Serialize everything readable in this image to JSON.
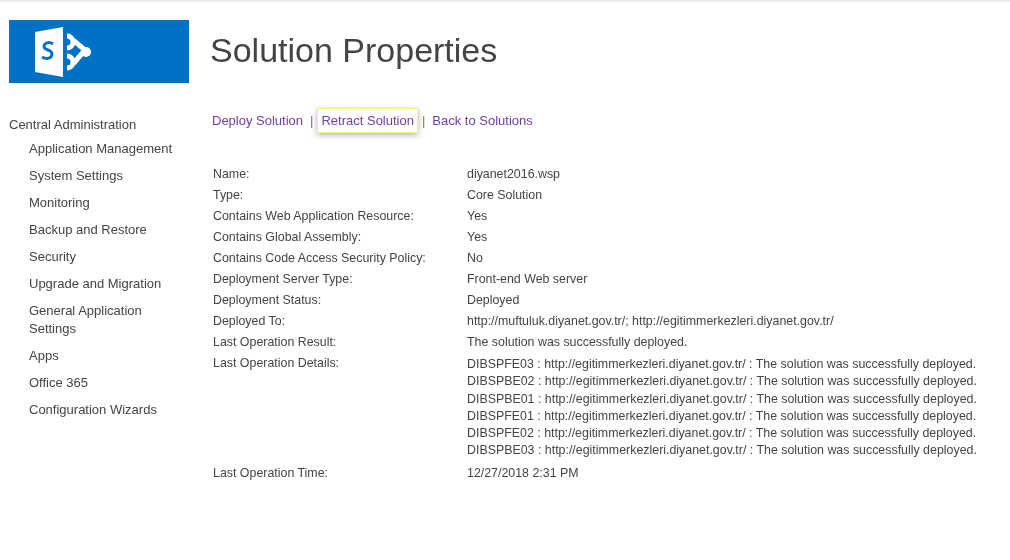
{
  "page_title": "Solution Properties",
  "sidebar": {
    "items": [
      {
        "label": "Central Administration",
        "children": [
          {
            "label": "Application Management"
          },
          {
            "label": "System Settings"
          },
          {
            "label": "Monitoring"
          },
          {
            "label": "Backup and Restore"
          },
          {
            "label": "Security"
          },
          {
            "label": "Upgrade and Migration"
          },
          {
            "label": "General Application Settings"
          },
          {
            "label": "Apps"
          },
          {
            "label": "Office 365"
          },
          {
            "label": "Configuration Wizards"
          }
        ]
      }
    ]
  },
  "action_links": [
    {
      "label": "Deploy Solution",
      "focused": false
    },
    {
      "label": "Retract Solution",
      "focused": true
    },
    {
      "label": "Back to Solutions",
      "focused": false
    }
  ],
  "link_separator": "|",
  "properties": [
    {
      "label": "Name:",
      "values": [
        "diyanet2016.wsp"
      ]
    },
    {
      "label": "Type:",
      "values": [
        "Core Solution"
      ]
    },
    {
      "label": "Contains Web Application Resource:",
      "values": [
        "Yes"
      ]
    },
    {
      "label": "Contains Global Assembly:",
      "values": [
        "Yes"
      ]
    },
    {
      "label": "Contains Code Access Security Policy:",
      "values": [
        "No"
      ]
    },
    {
      "label": "Deployment Server Type:",
      "values": [
        "Front-end Web server"
      ]
    },
    {
      "label": "Deployment Status:",
      "values": [
        "Deployed"
      ]
    },
    {
      "label": "Deployed To:",
      "values": [
        "http://muftuluk.diyanet.gov.tr/; http://egitimmerkezleri.diyanet.gov.tr/"
      ]
    },
    {
      "label": "Last Operation Result:",
      "values": [
        "The solution was successfully deployed."
      ]
    },
    {
      "label": "Last Operation Details:",
      "values": [
        "DIBSPFE03 : http://egitimmerkezleri.diyanet.gov.tr/ : The solution was successfully deployed.",
        "DIBSPBE02 : http://egitimmerkezleri.diyanet.gov.tr/ : The solution was successfully deployed.",
        "DIBSPBE01 : http://egitimmerkezleri.diyanet.gov.tr/ : The solution was successfully deployed.",
        "DIBSPFE01 : http://egitimmerkezleri.diyanet.gov.tr/ : The solution was successfully deployed.",
        "DIBSPFE02 : http://egitimmerkezleri.diyanet.gov.tr/ : The solution was successfully deployed.",
        "DIBSPBE03 : http://egitimmerkezleri.diyanet.gov.tr/ : The solution was successfully deployed."
      ]
    },
    {
      "label": "Last Operation Time:",
      "values": [
        "12/27/2018 2:31 PM"
      ]
    }
  ]
}
